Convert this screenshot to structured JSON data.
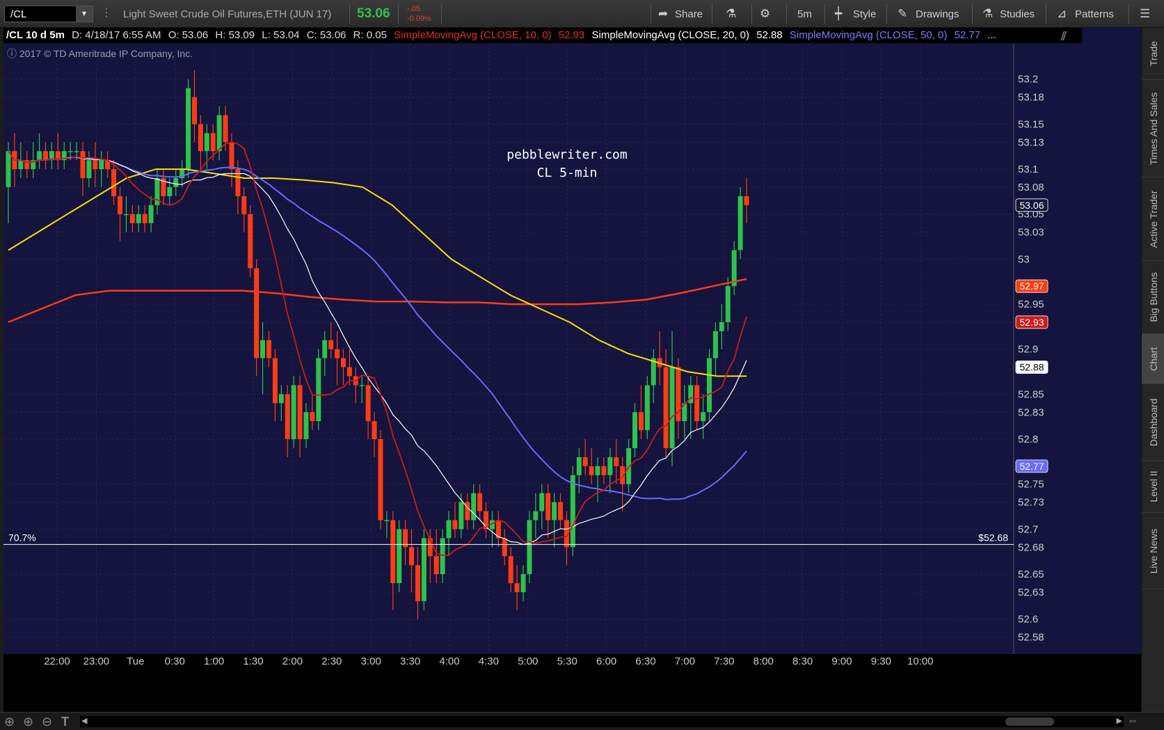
{
  "toolbar": {
    "symbol": "/CL",
    "description": "Light Sweet Crude Oil Futures,ETH (JUN 17)",
    "last": "53.06",
    "net_change": "-.05",
    "pct_change": "-0.09%",
    "share_label": "Share",
    "timeframe_label": "5m",
    "style_label": "Style",
    "drawings_label": "Drawings",
    "studies_label": "Studies",
    "patterns_label": "Patterns"
  },
  "infobar": {
    "symbol": "/CL 10 d 5m",
    "date": "D: 4/18/17 6:55 AM",
    "open": "O: 53.06",
    "high": "H: 53.09",
    "low": "L: 53.04",
    "close": "C: 53.06",
    "range": "R: 0.05",
    "sma10": "SimpleMovingAvg (CLOSE, 10, 0)",
    "sma10_val": "52.93",
    "sma20": "SimpleMovingAvg (CLOSE, 20, 0)",
    "sma20_val": "52.88",
    "sma50": "SimpleMovingAvg (CLOSE, 50, 0)",
    "sma50_val": "52.77",
    "more": "..."
  },
  "copyright": "2017 © TD Ameritrade IP Company, Inc.",
  "watermark": {
    "line1": "pebblewriter.com",
    "line2": "CL 5-min"
  },
  "side_tabs": [
    "Trade",
    "Times And Sales",
    "Active Trader",
    "Big Buttons",
    "Chart",
    "Dashboard",
    "Level II",
    "Live News"
  ],
  "chart_data": {
    "type": "candlestick",
    "ylim": [
      52.565,
      53.24
    ],
    "y_ticks": [
      53.2,
      53.18,
      53.15,
      53.13,
      53.1,
      53.08,
      53.05,
      53.03,
      53,
      52.95,
      52.93,
      52.9,
      52.85,
      52.83,
      52.8,
      52.75,
      52.73,
      52.7,
      52.68,
      52.65,
      52.63,
      52.6,
      52.58
    ],
    "x_ticks": [
      "22:00",
      "23:00",
      "Tue",
      "0:30",
      "1:00",
      "1:30",
      "2:00",
      "2:30",
      "3:00",
      "3:30",
      "4:00",
      "4:30",
      "5:00",
      "5:30",
      "6:00",
      "6:30",
      "7:00",
      "7:30",
      "8:00",
      "8:30",
      "9:00",
      "9:30",
      "10:00"
    ],
    "price_labels": [
      {
        "label": "53.06",
        "value": 53.06,
        "color": "#ffffff",
        "bg": "#14143e"
      },
      {
        "label": "52.97",
        "value": 52.97,
        "color": "#ffffff",
        "bg": "#ff3c14"
      },
      {
        "label": "52.93",
        "value": 52.93,
        "color": "#ffffff",
        "bg": "#cc1a1a"
      },
      {
        "label": "52.88",
        "value": 52.88,
        "color": "#000000",
        "bg": "#ffffff"
      },
      {
        "label": "52.77",
        "value": 52.77,
        "color": "#ffffff",
        "bg": "#6a6aff"
      }
    ],
    "horizontal_line": {
      "value": 52.683,
      "left_label": "70.7%",
      "right_label": "$52.68"
    },
    "candles": [
      [
        53.08,
        53.13,
        53.04,
        53.12
      ],
      [
        53.12,
        53.14,
        53.08,
        53.1
      ],
      [
        53.1,
        53.13,
        53.09,
        53.11
      ],
      [
        53.11,
        53.12,
        53.09,
        53.1
      ],
      [
        53.1,
        53.13,
        53.09,
        53.11
      ],
      [
        53.11,
        53.14,
        53.1,
        53.12
      ],
      [
        53.12,
        53.13,
        53.1,
        53.11
      ],
      [
        53.11,
        53.13,
        53.1,
        53.12
      ],
      [
        53.12,
        53.14,
        53.1,
        53.11
      ],
      [
        53.11,
        53.13,
        53.1,
        53.12
      ],
      [
        53.12,
        53.13,
        53.11,
        53.12
      ],
      [
        53.12,
        53.13,
        53.11,
        53.12
      ],
      [
        53.12,
        53.13,
        53.07,
        53.09
      ],
      [
        53.09,
        53.12,
        53.08,
        53.11
      ],
      [
        53.11,
        53.13,
        53.08,
        53.1
      ],
      [
        53.1,
        53.12,
        53.08,
        53.11
      ],
      [
        53.11,
        53.12,
        53.09,
        53.1
      ],
      [
        53.1,
        53.11,
        53.06,
        53.07
      ],
      [
        53.07,
        53.08,
        53.02,
        53.05
      ],
      [
        53.05,
        53.07,
        53.03,
        53.05
      ],
      [
        53.05,
        53.06,
        53.03,
        53.04
      ],
      [
        53.04,
        53.06,
        53.03,
        53.05
      ],
      [
        53.05,
        53.06,
        53.03,
        53.04
      ],
      [
        53.04,
        53.07,
        53.03,
        53.06
      ],
      [
        53.06,
        53.1,
        53.05,
        53.09
      ],
      [
        53.09,
        53.1,
        53.06,
        53.07
      ],
      [
        53.07,
        53.09,
        53.06,
        53.08
      ],
      [
        53.08,
        53.1,
        53.07,
        53.09
      ],
      [
        53.09,
        53.11,
        53.08,
        53.1
      ],
      [
        53.1,
        53.2,
        53.09,
        53.19
      ],
      [
        53.18,
        53.21,
        53.13,
        53.15
      ],
      [
        53.15,
        53.16,
        53.1,
        53.12
      ],
      [
        53.12,
        53.15,
        53.1,
        53.14
      ],
      [
        53.14,
        53.15,
        53.11,
        53.12
      ],
      [
        53.12,
        53.17,
        53.11,
        53.16
      ],
      [
        53.16,
        53.17,
        53.12,
        53.13
      ],
      [
        53.13,
        53.14,
        53.08,
        53.1
      ],
      [
        53.1,
        53.11,
        53.05,
        53.07
      ],
      [
        53.07,
        53.08,
        53.03,
        53.05
      ],
      [
        53.05,
        53.06,
        52.98,
        52.99
      ],
      [
        52.99,
        53.0,
        52.87,
        52.89
      ],
      [
        52.89,
        52.93,
        52.85,
        52.91
      ],
      [
        52.91,
        52.92,
        52.88,
        52.89
      ],
      [
        52.89,
        52.9,
        52.82,
        52.84
      ],
      [
        52.84,
        52.86,
        52.82,
        52.85
      ],
      [
        52.85,
        52.86,
        52.78,
        52.8
      ],
      [
        52.8,
        52.87,
        52.79,
        52.86
      ],
      [
        52.86,
        52.87,
        52.78,
        52.8
      ],
      [
        52.8,
        52.84,
        52.79,
        52.83
      ],
      [
        52.83,
        52.85,
        52.81,
        52.82
      ],
      [
        52.82,
        52.9,
        52.81,
        52.89
      ],
      [
        52.89,
        52.92,
        52.87,
        52.91
      ],
      [
        52.91,
        52.93,
        52.89,
        52.9
      ],
      [
        52.9,
        52.92,
        52.86,
        52.89
      ],
      [
        52.89,
        52.9,
        52.86,
        52.88
      ],
      [
        52.88,
        52.9,
        52.86,
        52.87
      ],
      [
        52.87,
        52.88,
        52.84,
        52.86
      ],
      [
        52.86,
        52.87,
        52.84,
        52.86
      ],
      [
        52.86,
        52.87,
        52.8,
        52.82
      ],
      [
        52.82,
        52.83,
        52.78,
        52.8
      ],
      [
        52.8,
        52.81,
        52.7,
        52.71
      ],
      [
        52.71,
        52.72,
        52.69,
        52.71
      ],
      [
        52.71,
        52.72,
        52.61,
        52.64
      ],
      [
        52.64,
        52.71,
        52.63,
        52.7
      ],
      [
        52.7,
        52.71,
        52.66,
        52.68
      ],
      [
        52.68,
        52.7,
        52.63,
        52.66
      ],
      [
        52.66,
        52.68,
        52.6,
        52.62
      ],
      [
        52.62,
        52.7,
        52.61,
        52.69
      ],
      [
        52.69,
        52.7,
        52.64,
        52.67
      ],
      [
        52.67,
        52.7,
        52.64,
        52.65
      ],
      [
        52.65,
        52.7,
        52.64,
        52.69
      ],
      [
        52.69,
        52.72,
        52.67,
        52.71
      ],
      [
        52.71,
        52.73,
        52.69,
        52.7
      ],
      [
        52.7,
        52.74,
        52.69,
        52.73
      ],
      [
        52.73,
        52.74,
        52.7,
        52.71
      ],
      [
        52.71,
        52.75,
        52.7,
        52.74
      ],
      [
        52.74,
        52.75,
        52.71,
        52.72
      ],
      [
        52.72,
        52.73,
        52.69,
        52.7
      ],
      [
        52.7,
        52.72,
        52.68,
        52.71
      ],
      [
        52.71,
        52.72,
        52.68,
        52.69
      ],
      [
        52.69,
        52.7,
        52.66,
        52.67
      ],
      [
        52.67,
        52.68,
        52.63,
        52.64
      ],
      [
        52.64,
        52.66,
        52.61,
        52.63
      ],
      [
        52.63,
        52.66,
        52.62,
        52.65
      ],
      [
        52.65,
        52.72,
        52.64,
        52.71
      ],
      [
        52.71,
        52.74,
        52.69,
        52.72
      ],
      [
        52.72,
        52.75,
        52.7,
        52.74
      ],
      [
        52.74,
        52.75,
        52.69,
        52.71
      ],
      [
        52.71,
        52.74,
        52.68,
        52.73
      ],
      [
        52.73,
        52.74,
        52.7,
        52.71
      ],
      [
        52.71,
        52.72,
        52.66,
        52.68
      ],
      [
        52.68,
        52.77,
        52.67,
        52.76
      ],
      [
        52.76,
        52.79,
        52.74,
        52.78
      ],
      [
        52.78,
        52.8,
        52.76,
        52.77
      ],
      [
        52.77,
        52.79,
        52.75,
        52.76
      ],
      [
        52.76,
        52.78,
        52.73,
        52.77
      ],
      [
        52.77,
        52.78,
        52.75,
        52.76
      ],
      [
        52.76,
        52.79,
        52.74,
        52.78
      ],
      [
        52.78,
        52.8,
        52.75,
        52.77
      ],
      [
        52.77,
        52.78,
        52.72,
        52.75
      ],
      [
        52.75,
        52.8,
        52.74,
        52.79
      ],
      [
        52.79,
        52.84,
        52.78,
        52.83
      ],
      [
        52.83,
        52.86,
        52.8,
        52.81
      ],
      [
        52.81,
        52.87,
        52.8,
        52.86
      ],
      [
        52.86,
        52.9,
        52.84,
        52.89
      ],
      [
        52.89,
        52.92,
        52.86,
        52.88
      ],
      [
        52.88,
        52.9,
        52.78,
        52.79
      ],
      [
        52.79,
        52.92,
        52.77,
        52.88
      ],
      [
        52.88,
        52.89,
        52.8,
        52.82
      ],
      [
        52.82,
        52.86,
        52.8,
        52.84
      ],
      [
        52.84,
        52.87,
        52.8,
        52.86
      ],
      [
        52.86,
        52.87,
        52.81,
        52.82
      ],
      [
        52.82,
        52.85,
        52.8,
        52.83
      ],
      [
        52.83,
        52.9,
        52.82,
        52.89
      ],
      [
        52.89,
        52.93,
        52.87,
        52.92
      ],
      [
        52.92,
        52.95,
        52.9,
        52.93
      ],
      [
        52.93,
        52.98,
        52.92,
        52.97
      ],
      [
        52.97,
        53.02,
        52.96,
        53.01
      ],
      [
        53.01,
        53.08,
        53.0,
        53.07
      ],
      [
        53.07,
        53.09,
        53.04,
        53.06
      ]
    ],
    "sma_series": [
      {
        "name": "SimpleMovingAvg (CLOSE, 10, 0)",
        "color": "#cc1a1a",
        "end": 52.93
      },
      {
        "name": "SimpleMovingAvg (CLOSE, 20, 0)",
        "color": "#ffffff",
        "end": 52.88
      },
      {
        "name": "SimpleMovingAvg (CLOSE, 50, 0)",
        "color": "#6a6aff",
        "end": 52.77
      }
    ],
    "long_sma_yellow": [
      53.01,
      53.03,
      53.05,
      53.07,
      53.09,
      53.1,
      53.1,
      53.095,
      53.09,
      53.09,
      53.088,
      53.085,
      53.08,
      53.06,
      53.03,
      53.0,
      52.98,
      52.96,
      52.945,
      52.93,
      52.91,
      52.895,
      52.885,
      52.875,
      52.87,
      52.87
    ],
    "long_sma_orange": [
      52.93,
      52.945,
      52.96,
      52.965,
      52.965,
      52.965,
      52.965,
      52.965,
      52.962,
      52.958,
      52.955,
      52.953,
      52.953,
      52.952,
      52.952,
      52.95,
      52.95,
      52.95,
      52.952,
      52.955,
      52.962,
      52.97,
      52.978
    ]
  }
}
